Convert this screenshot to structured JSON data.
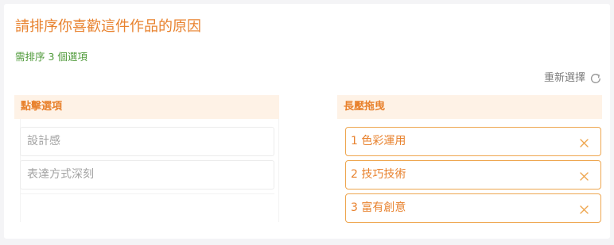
{
  "question": {
    "title": "請排序你喜歡這件作品的原因",
    "instruction": "需排序 3 個選項"
  },
  "reset": {
    "label": "重新選擇",
    "icon": "refresh-icon"
  },
  "left_panel": {
    "header": "點擊選項",
    "items": [
      {
        "label": "設計感"
      },
      {
        "label": "表達方式深刻"
      }
    ]
  },
  "right_panel": {
    "header": "長壓拖曳",
    "items": [
      {
        "label": "1 色彩運用",
        "icon": "close-icon"
      },
      {
        "label": "2 技巧技術",
        "icon": "close-icon"
      },
      {
        "label": "3 富有創意",
        "icon": "close-icon"
      }
    ]
  },
  "colors": {
    "accent": "#e8822e",
    "header_bg": "#fef2e6",
    "instruction": "#4f9a3a",
    "item_border": "#eea64f"
  }
}
